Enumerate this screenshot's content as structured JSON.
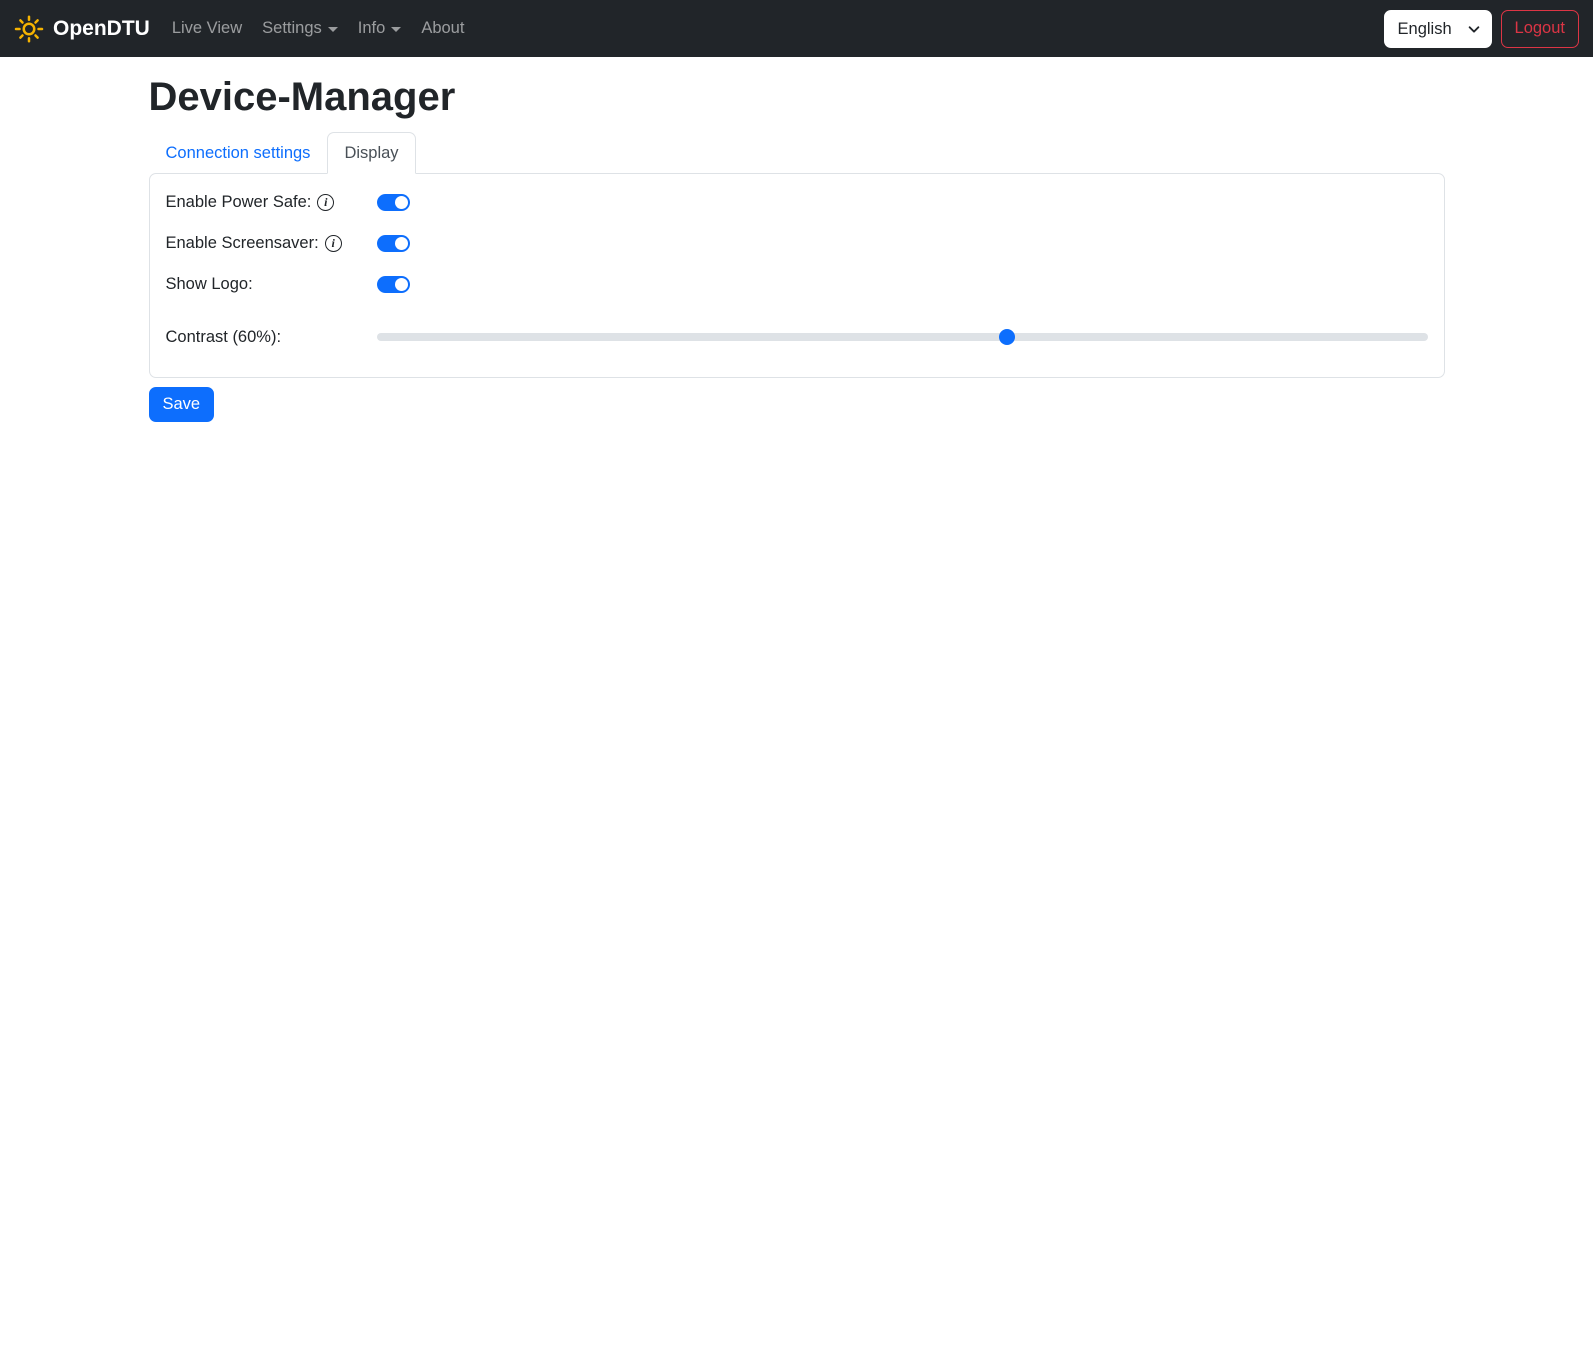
{
  "navbar": {
    "brand": "OpenDTU",
    "items": [
      {
        "label": "Live View",
        "dropdown": false
      },
      {
        "label": "Settings",
        "dropdown": true
      },
      {
        "label": "Info",
        "dropdown": true
      },
      {
        "label": "About",
        "dropdown": false
      }
    ],
    "language_selected": "English",
    "logout_label": "Logout"
  },
  "page": {
    "title": "Device-Manager",
    "tabs": [
      {
        "label": "Connection settings",
        "active": false
      },
      {
        "label": "Display",
        "active": true
      }
    ]
  },
  "form": {
    "rows": [
      {
        "label": "Enable Power Safe:",
        "type": "switch",
        "value": true,
        "info": true
      },
      {
        "label": "Enable Screensaver:",
        "type": "switch",
        "value": true,
        "info": true
      },
      {
        "label": "Show Logo:",
        "type": "switch",
        "value": true,
        "info": false
      },
      {
        "label": "Contrast (60%):",
        "type": "range",
        "value": 60,
        "min": 0,
        "max": 100
      }
    ],
    "save_label": "Save"
  },
  "colors": {
    "primary": "#0d6efd",
    "danger": "#dc3545",
    "navbar_bg": "#212529",
    "brand_icon": "#f5b301",
    "border": "#dee2e6",
    "track": "#dee2e6"
  }
}
